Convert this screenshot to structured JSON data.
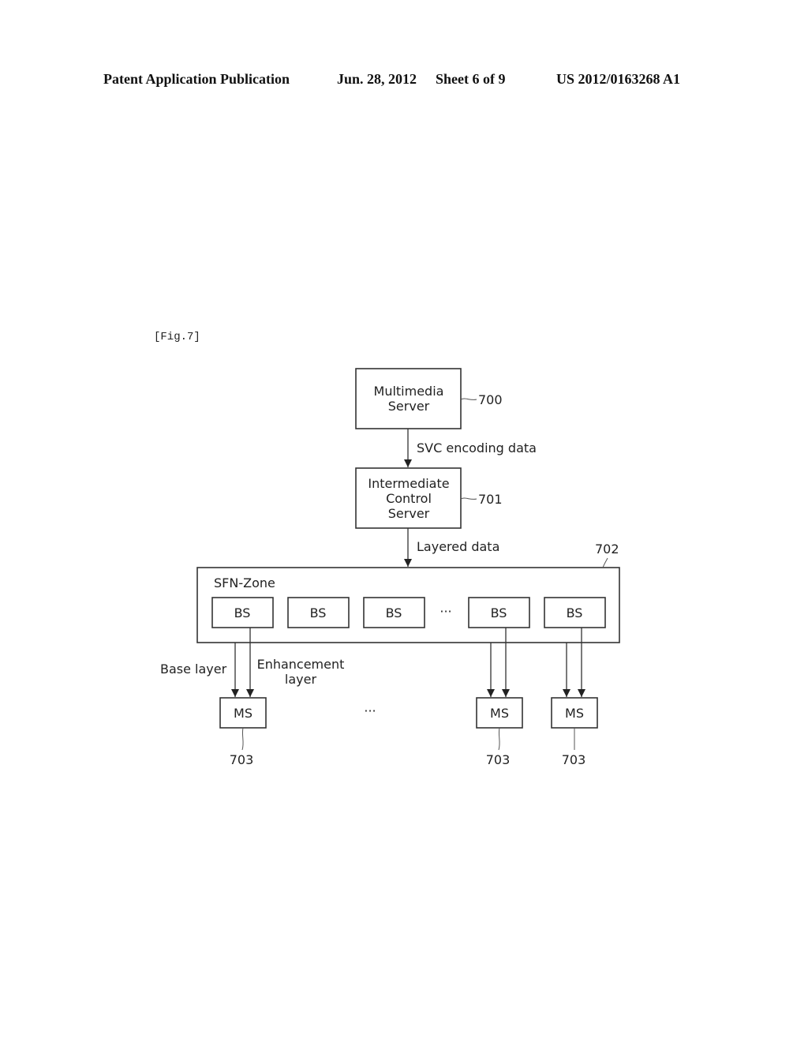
{
  "header": {
    "publication": "Patent Application Publication",
    "date": "Jun. 28, 2012",
    "sheet": "Sheet 6 of 9",
    "number": "US 2012/0163268 A1"
  },
  "figure": {
    "label": "[Fig.7]",
    "multimedia_server": {
      "line1": "Multimedia",
      "line2": "Server",
      "ref": "700"
    },
    "edge1_label": "SVC encoding data",
    "control_server": {
      "line1": "Intermediate",
      "line2": "Control",
      "line3": "Server",
      "ref": "701"
    },
    "edge2_label": "Layered data",
    "zone": {
      "label": "SFN-Zone",
      "ref": "702"
    },
    "base_stations": [
      "BS",
      "BS",
      "BS",
      "BS",
      "BS"
    ],
    "ellipsis": "···",
    "base_layer_label": "Base layer",
    "enhancement_label_line1": "Enhancement",
    "enhancement_label_line2": "layer",
    "mobile_stations": [
      {
        "label": "MS",
        "ref": "703"
      },
      {
        "label": "MS",
        "ref": "703"
      },
      {
        "label": "MS",
        "ref": "703"
      }
    ]
  }
}
